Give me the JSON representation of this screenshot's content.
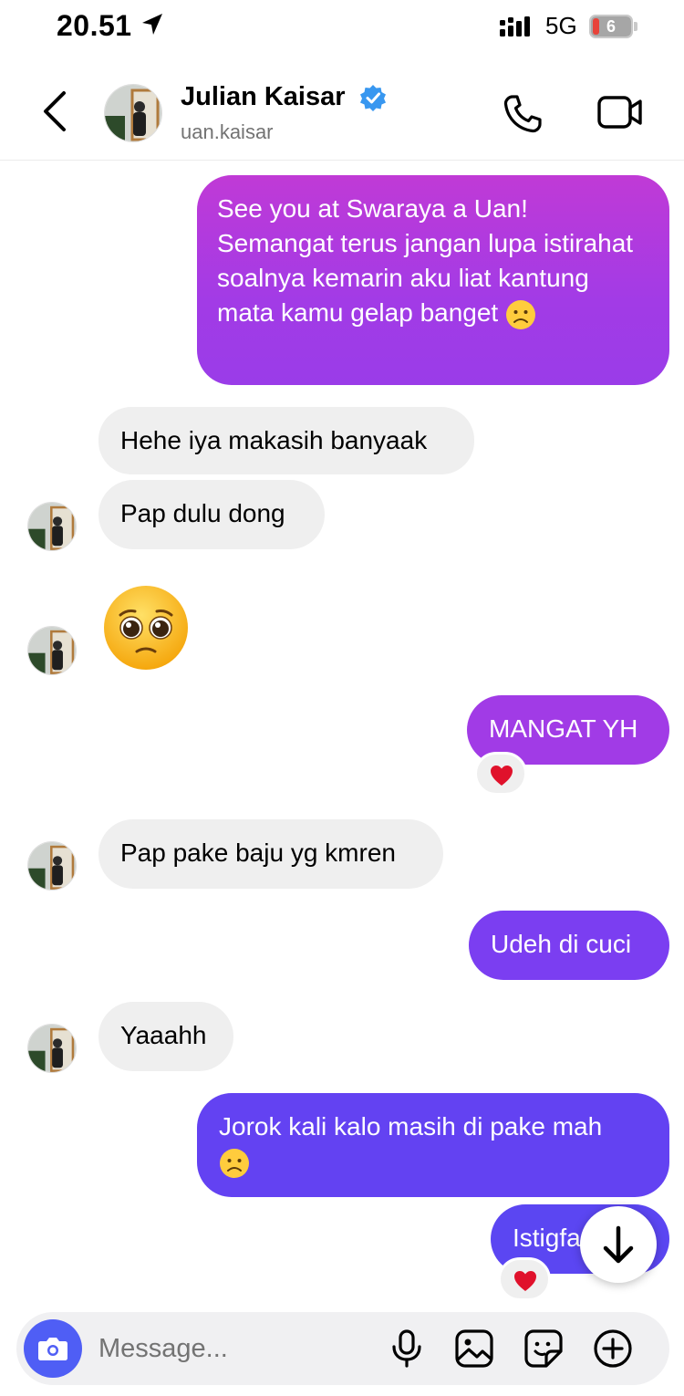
{
  "status_bar": {
    "time": "20.51",
    "network": "5G",
    "battery_level": "6",
    "icons": [
      "location-arrow-icon",
      "signal-icon",
      "battery-icon"
    ]
  },
  "header": {
    "contact_name": "Julian Kaisar",
    "username": "uan.kaisar",
    "verified": true,
    "icons": [
      "back-chevron-icon",
      "verified-badge-icon",
      "phone-icon",
      "video-camera-icon"
    ]
  },
  "messages": [
    {
      "from": "me",
      "text": "See you at Swaraya a Uan! Semangat terus jangan lupa istirahat soalnya kemarin aku liat kantung mata kamu gelap banget",
      "emoji": "frowning-face"
    },
    {
      "from": "them",
      "text": "Hehe iya makasih banyaak"
    },
    {
      "from": "them",
      "text": "Pap dulu dong"
    },
    {
      "from": "them",
      "emoji": "pleading-face"
    },
    {
      "from": "me",
      "text": "MANGAT YH",
      "reaction": "red-heart"
    },
    {
      "from": "them",
      "text": "Pap pake baju yg kmren"
    },
    {
      "from": "me",
      "text": "Udeh di cuci"
    },
    {
      "from": "them",
      "text": "Yaaahh"
    },
    {
      "from": "me",
      "text": "Jorok kali kalo masih di pake mah",
      "emoji": "frowning-face"
    },
    {
      "from": "me",
      "text": "Istigfa",
      "reaction": "red-heart"
    }
  ],
  "composer": {
    "placeholder": "Message...",
    "icons": [
      "camera-icon",
      "microphone-icon",
      "gallery-icon",
      "sticker-icon",
      "plus-icon"
    ]
  },
  "colors": {
    "gradient_top": "#c03ad6",
    "gradient_mid": "#8a3cf0",
    "gradient_bottom": "#5b46f2",
    "incoming_bubble": "#efefef",
    "verified_blue": "#3897f0",
    "camera_button": "#4f5ef5",
    "heart_red": "#e0112b"
  }
}
